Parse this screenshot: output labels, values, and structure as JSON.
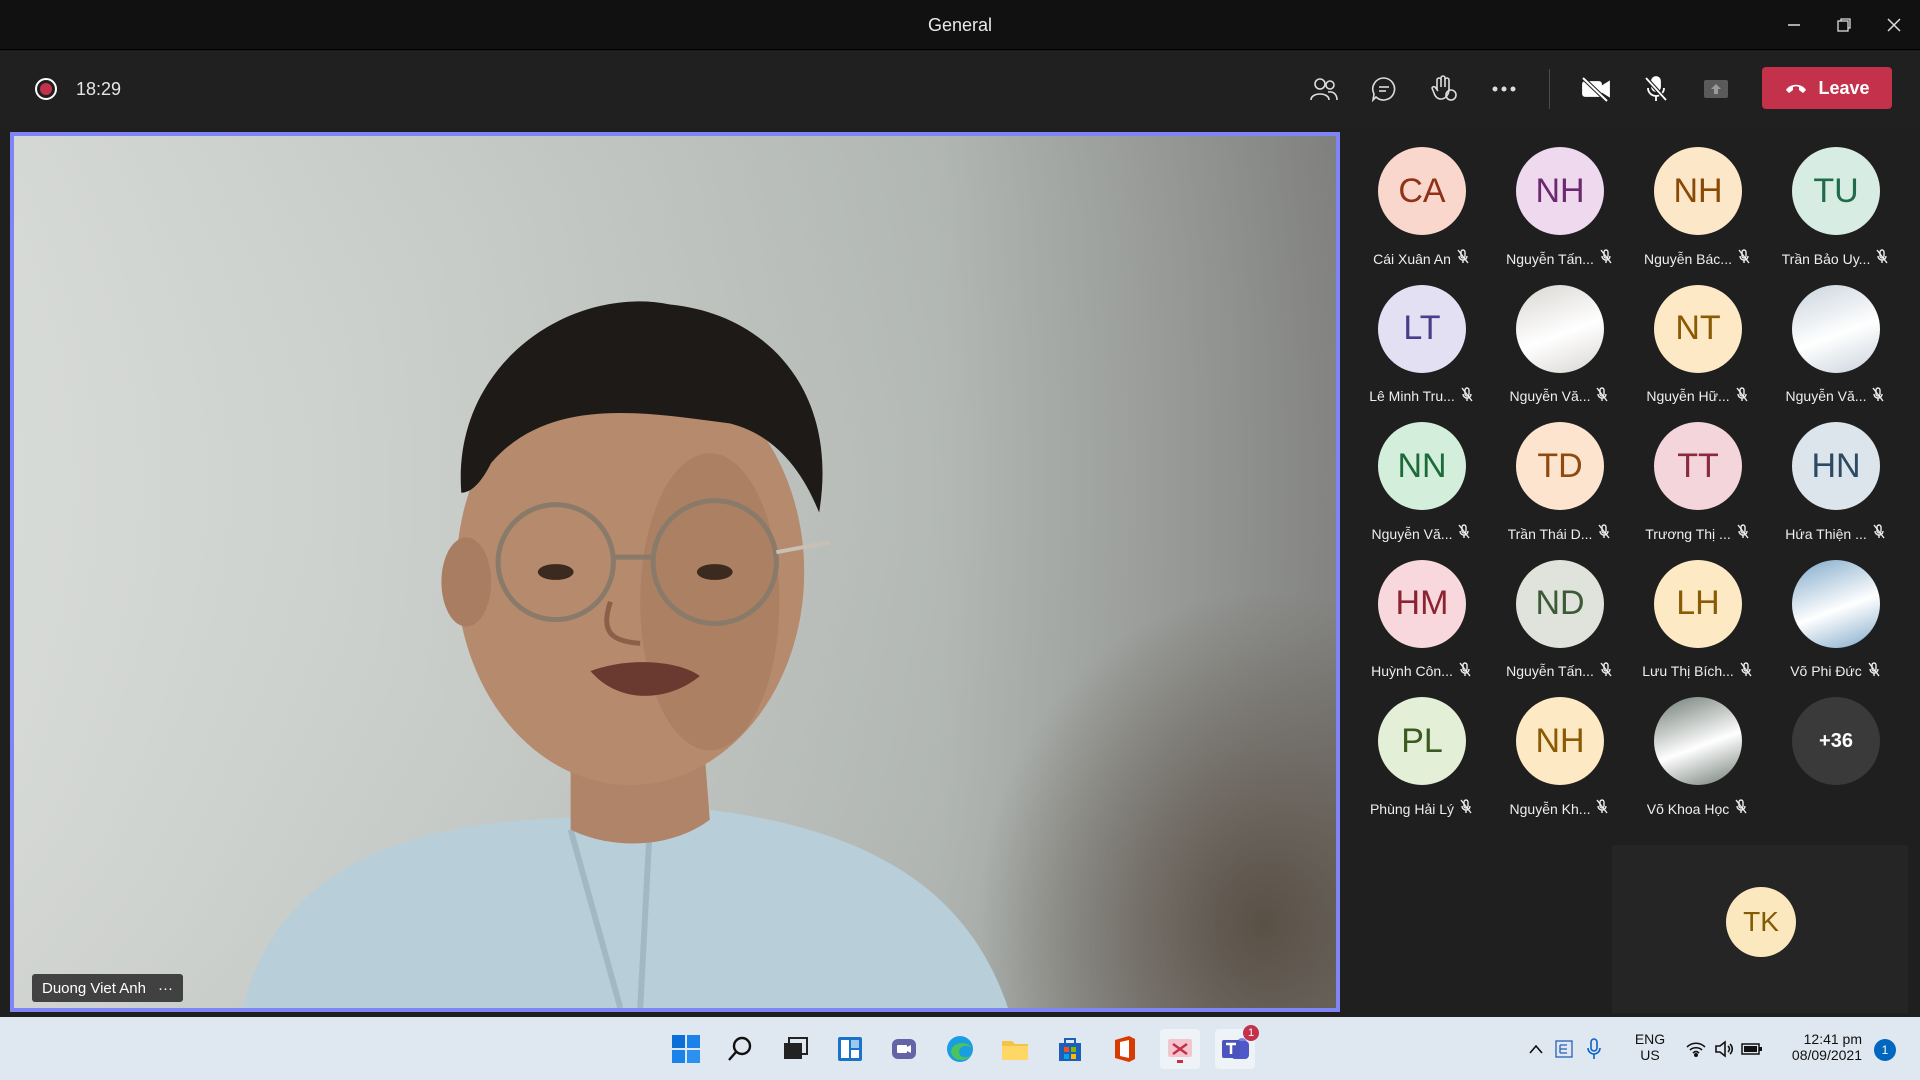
{
  "window": {
    "title": "General"
  },
  "call": {
    "timer": "18:29",
    "leave_label": "Leave"
  },
  "stage": {
    "speaker_name": "Duong Viet Anh",
    "speaker_more": "···"
  },
  "participants": [
    {
      "initials": "CA",
      "name": "Cái Xuân An",
      "bg": "#f9d7cc",
      "fg": "#8f3217"
    },
    {
      "initials": "NH",
      "name": "Nguyễn Tấn...",
      "bg": "#eed9ef",
      "fg": "#6b2a6e"
    },
    {
      "initials": "NH",
      "name": "Nguyễn Bác...",
      "bg": "#fde7c9",
      "fg": "#8a4a05"
    },
    {
      "initials": "TU",
      "name": "Trần Bảo Uy...",
      "bg": "#d7ece3",
      "fg": "#1f6b4a"
    },
    {
      "initials": "LT",
      "name": "Lê Minh Tru...",
      "bg": "#e4e0f4",
      "fg": "#4b3c8a"
    },
    {
      "initials": "",
      "name": "Nguyễn Vă...",
      "bg": "#d9d6d2",
      "fg": "#555"
    },
    {
      "initials": "NT",
      "name": "Nguyễn Hữ...",
      "bg": "#fde9c6",
      "fg": "#8a5a05"
    },
    {
      "initials": "",
      "name": "Nguyễn Vă...",
      "bg": "#c9d3dc",
      "fg": "#333"
    },
    {
      "initials": "NN",
      "name": "Nguyễn Vă...",
      "bg": "#d3efdc",
      "fg": "#1d6b3a"
    },
    {
      "initials": "TD",
      "name": "Trần Thái D...",
      "bg": "#fde4cf",
      "fg": "#8f4a12"
    },
    {
      "initials": "TT",
      "name": "Trương Thị ...",
      "bg": "#f4d5dc",
      "fg": "#8a2a3e"
    },
    {
      "initials": "HN",
      "name": "Hứa Thiện ...",
      "bg": "#dce5ec",
      "fg": "#2d4a63"
    },
    {
      "initials": "HM",
      "name": "Huỳnh Côn...",
      "bg": "#f8d8dc",
      "fg": "#8a2431"
    },
    {
      "initials": "ND",
      "name": "Nguyễn Tấn...",
      "bg": "#dfe3dc",
      "fg": "#3d5a36"
    },
    {
      "initials": "LH",
      "name": "Lưu Thị Bích...",
      "bg": "#fde9c3",
      "fg": "#8a5a05"
    },
    {
      "initials": "",
      "name": "Võ Phi Đức",
      "bg": "#7fa8c9",
      "fg": "#fff"
    },
    {
      "initials": "PL",
      "name": "Phùng Hải Lý",
      "bg": "#e4efd8",
      "fg": "#3b5a1f"
    },
    {
      "initials": "NH",
      "name": "Nguyễn Kh...",
      "bg": "#fde9c3",
      "fg": "#8a5a05"
    },
    {
      "initials": "",
      "name": "Võ Khoa Học",
      "bg": "#6e7a72",
      "fg": "#fff"
    }
  ],
  "overflow_count": "+36",
  "self": {
    "initials": "TK"
  },
  "taskbar": {
    "language": "ENG",
    "region": "US",
    "time": "12:41 pm",
    "date": "08/09/2021",
    "notification_count": "1",
    "teams_badge": "1"
  }
}
